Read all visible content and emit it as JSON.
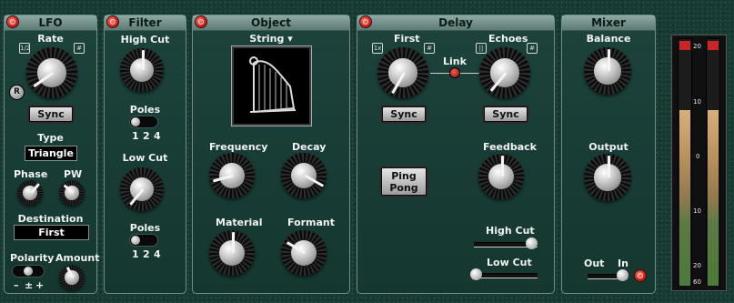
{
  "lfo": {
    "title": "LFO",
    "rate": "Rate",
    "rate_mode": "1/2",
    "retrigger": "R",
    "sync": "Sync",
    "type_label": "Type",
    "type_value": "Triangle",
    "phase": "Phase",
    "pw": "PW",
    "destination_label": "Destination",
    "destination_value": "First",
    "polarity": "Polarity",
    "polarity_minus": "–",
    "polarity_pm": "±",
    "polarity_plus": "+",
    "amount": "Amount"
  },
  "filter": {
    "title": "Filter",
    "high_cut": "High Cut",
    "poles1": "Poles",
    "low_cut": "Low Cut",
    "poles2": "Poles",
    "pole_1": "1",
    "pole_2": "2",
    "pole_4": "4"
  },
  "object": {
    "title": "Object",
    "type": "String ▾",
    "frequency": "Frequency",
    "decay": "Decay",
    "material": "Material",
    "formant": "Formant"
  },
  "delay": {
    "title": "Delay",
    "first": "First",
    "first_mode": "1x",
    "link": "Link",
    "echoes": "Echoes",
    "sync1": "Sync",
    "sync2": "Sync",
    "ping_pong_1": "Ping",
    "ping_pong_2": "Pong",
    "feedback": "Feedback",
    "high_cut": "High Cut",
    "low_cut": "Low Cut"
  },
  "mixer": {
    "title": "Mixer",
    "balance": "Balance",
    "output": "Output",
    "out": "Out",
    "in": "In"
  },
  "meter": {
    "ticks": [
      "20",
      "10",
      "0",
      "10",
      "20",
      "60"
    ],
    "level_left": 0.71,
    "level_right": 0.71
  },
  "colors": {
    "accent": "#d6201a",
    "panel": "#1c433c",
    "title_bar": "#8ea9a3"
  }
}
